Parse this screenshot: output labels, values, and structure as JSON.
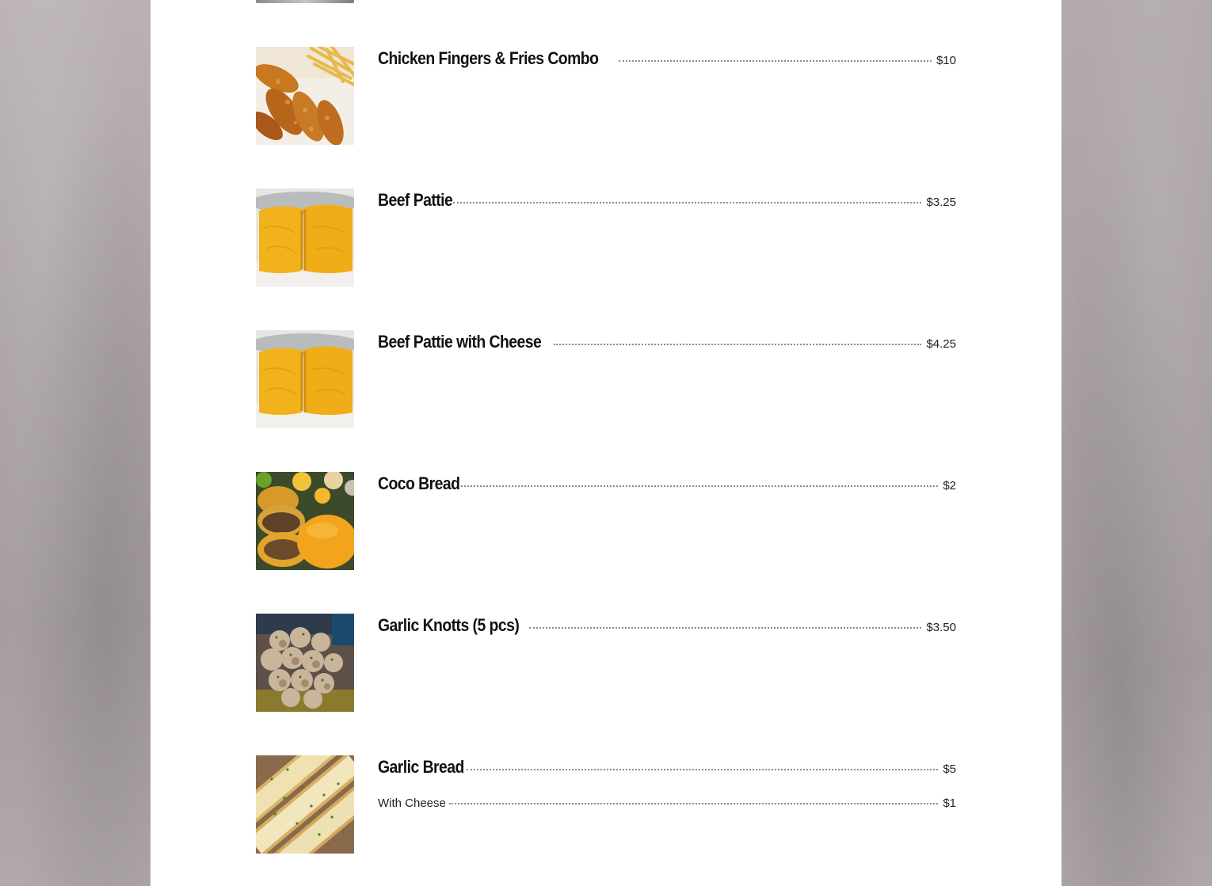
{
  "menu": {
    "items": [
      {
        "name": "Chicken Fingers & Fries Combo",
        "price": "$10",
        "image_icon": "chicken-fingers-fries-photo"
      },
      {
        "name": "Beef Pattie",
        "price": "$3.25",
        "image_icon": "beef-pattie-photo"
      },
      {
        "name": "Beef Pattie with Cheese",
        "price": "$4.25",
        "image_icon": "beef-pattie-cheese-photo"
      },
      {
        "name": "Coco Bread",
        "price": "$2",
        "image_icon": "coco-bread-photo"
      },
      {
        "name": "Garlic Knotts (5 pcs)",
        "price": "$3.50",
        "image_icon": "garlic-knots-photo"
      },
      {
        "name": "Garlic Bread",
        "price": "$5",
        "image_icon": "garlic-bread-photo",
        "variant": {
          "name": "With Cheese",
          "price": "$1"
        }
      }
    ]
  },
  "colors": {
    "panel": "#ffffff",
    "backdrop": "#a39b9d",
    "text": "#111111",
    "leader": "#8a8a8a"
  }
}
